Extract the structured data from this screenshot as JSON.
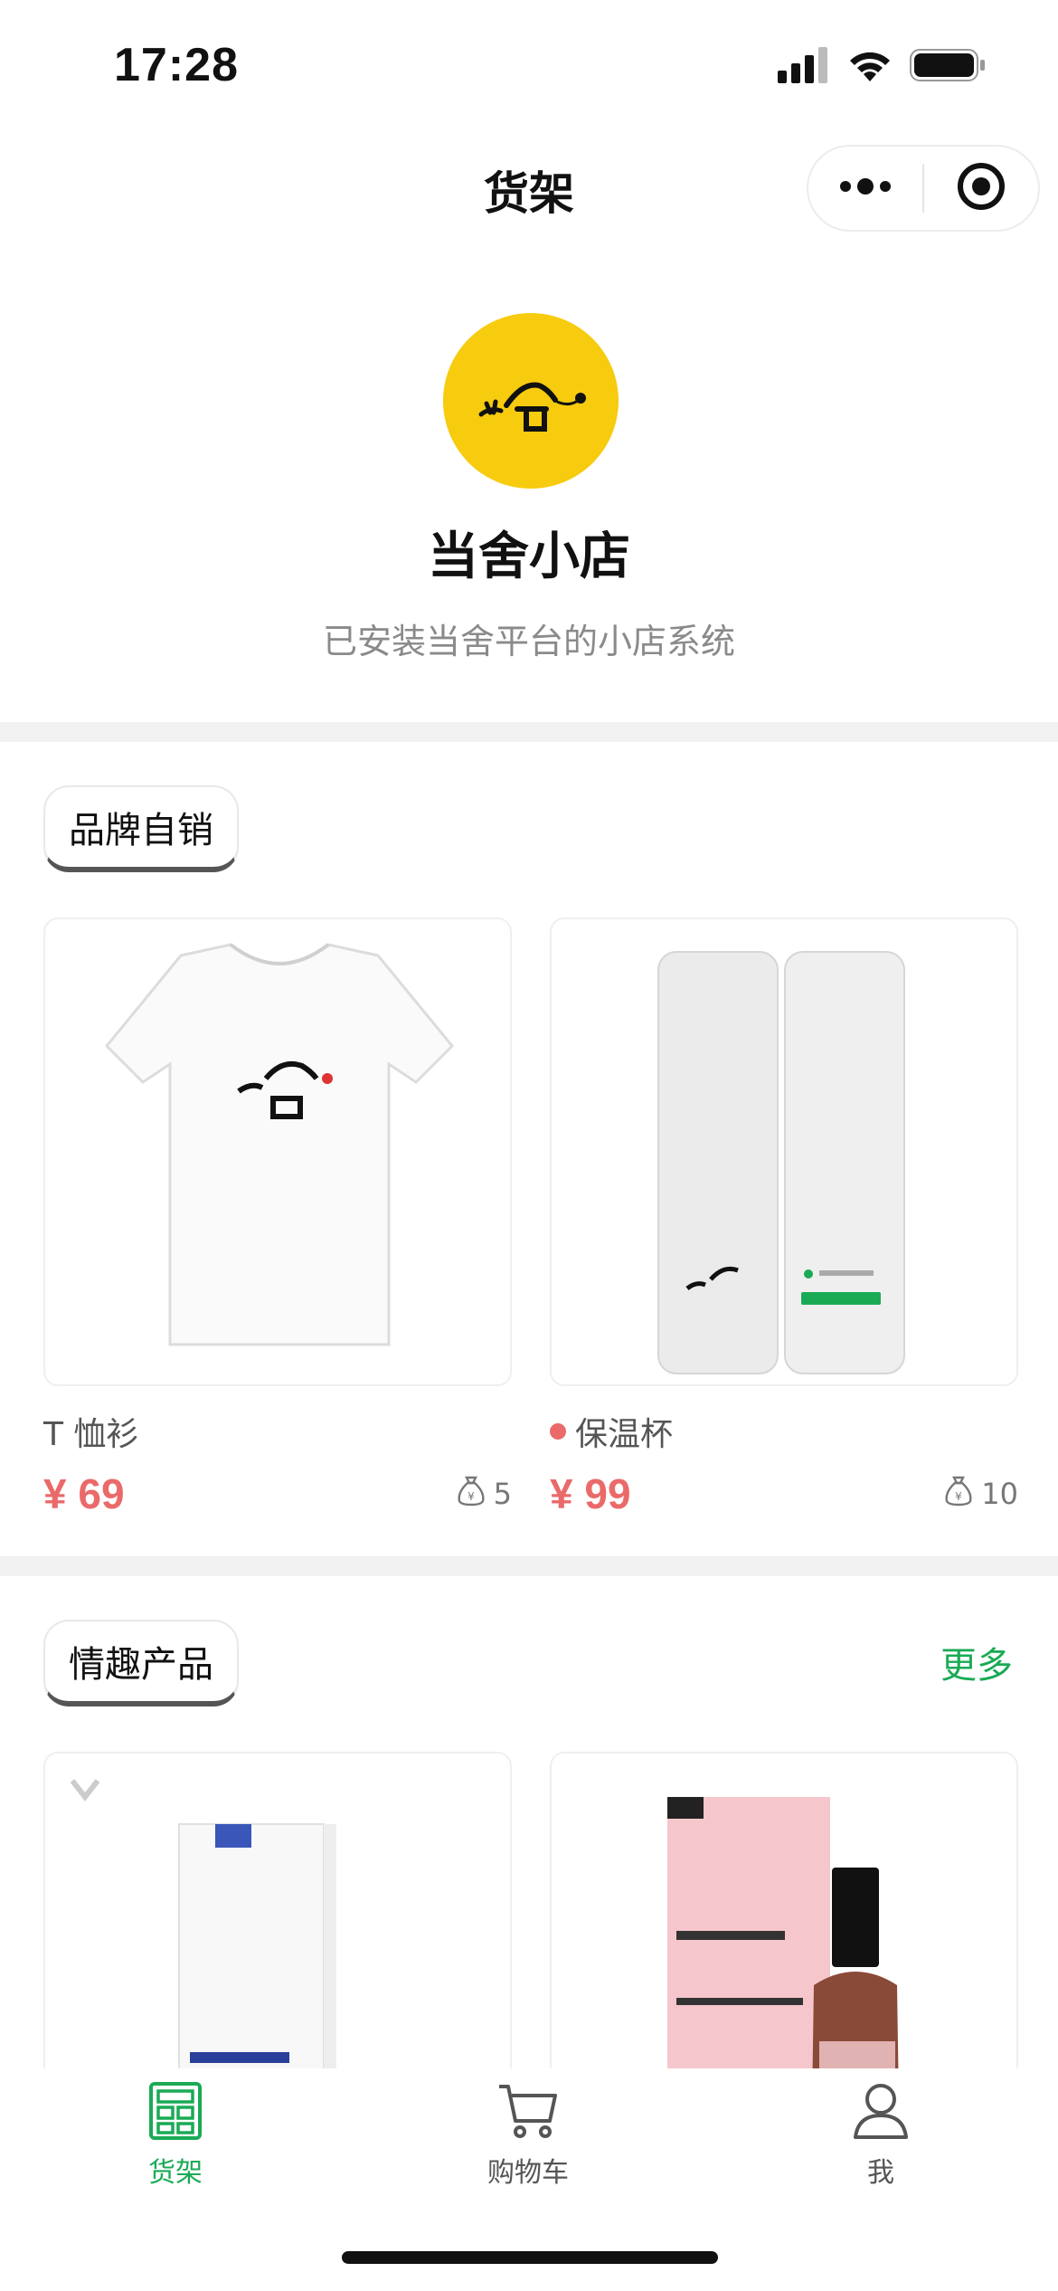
{
  "status_bar": {
    "time": "17:28"
  },
  "nav": {
    "title": "货架"
  },
  "shop": {
    "name": "当舍小店",
    "description": "已安装当舍平台的小店系统"
  },
  "sections": [
    {
      "title": "品牌自销",
      "more": "",
      "products": [
        {
          "title": "T 恤衫",
          "price": "¥ 69",
          "sales": "5",
          "badge_dot": false
        },
        {
          "title": "保温杯",
          "price": "¥ 99",
          "sales": "10",
          "badge_dot": true
        }
      ]
    },
    {
      "title": "情趣产品",
      "more": "更多",
      "products": [
        {
          "title": "",
          "price": "",
          "sales": "",
          "badge_dot": false
        },
        {
          "title": "",
          "price": "",
          "sales": "",
          "badge_dot": false
        }
      ]
    }
  ],
  "tabbar": {
    "items": [
      {
        "label": "货架",
        "icon": "shelf-icon",
        "active": true
      },
      {
        "label": "购物车",
        "icon": "cart-icon",
        "active": false
      },
      {
        "label": "我",
        "icon": "user-icon",
        "active": false
      }
    ]
  },
  "colors": {
    "accent": "#1aaa55",
    "price": "#ea6a6a",
    "logo_bg": "#f7cb0e"
  }
}
